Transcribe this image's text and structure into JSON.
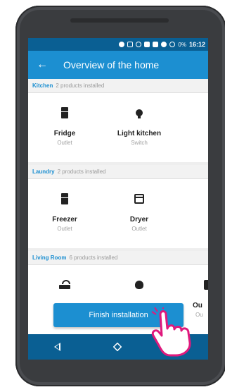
{
  "status_bar": {
    "battery_text": "0%",
    "time": "16:12"
  },
  "app_bar": {
    "back_icon": "arrow-back-icon",
    "title": "Overview of the home"
  },
  "sections": [
    {
      "name": "Kitchen",
      "count": "2 products installed",
      "products": [
        {
          "name": "Fridge",
          "type": "Outlet",
          "icon": "fridge-icon"
        },
        {
          "name": "Light kitchen",
          "type": "Switch",
          "icon": "bulb-icon"
        }
      ]
    },
    {
      "name": "Laundry",
      "count": "2 products installed",
      "products": [
        {
          "name": "Freezer",
          "type": "Outlet",
          "icon": "freezer-icon"
        },
        {
          "name": "Dryer",
          "type": "Outlet",
          "icon": "dryer-icon"
        }
      ]
    },
    {
      "name": "Living Room",
      "count": "6 products installed",
      "products": [
        {
          "name": "",
          "type": "",
          "icon": "router-icon"
        },
        {
          "name": "",
          "type": "",
          "icon": "lamp-icon"
        },
        {
          "name": "Ou",
          "type": "Ou",
          "icon": "outlet-icon"
        }
      ]
    }
  ],
  "finish_button": {
    "label": "Finish installation"
  },
  "colors": {
    "primary": "#1c8fd1",
    "primary_dark": "#0a5f93",
    "hand_accent": "#e0197d"
  }
}
